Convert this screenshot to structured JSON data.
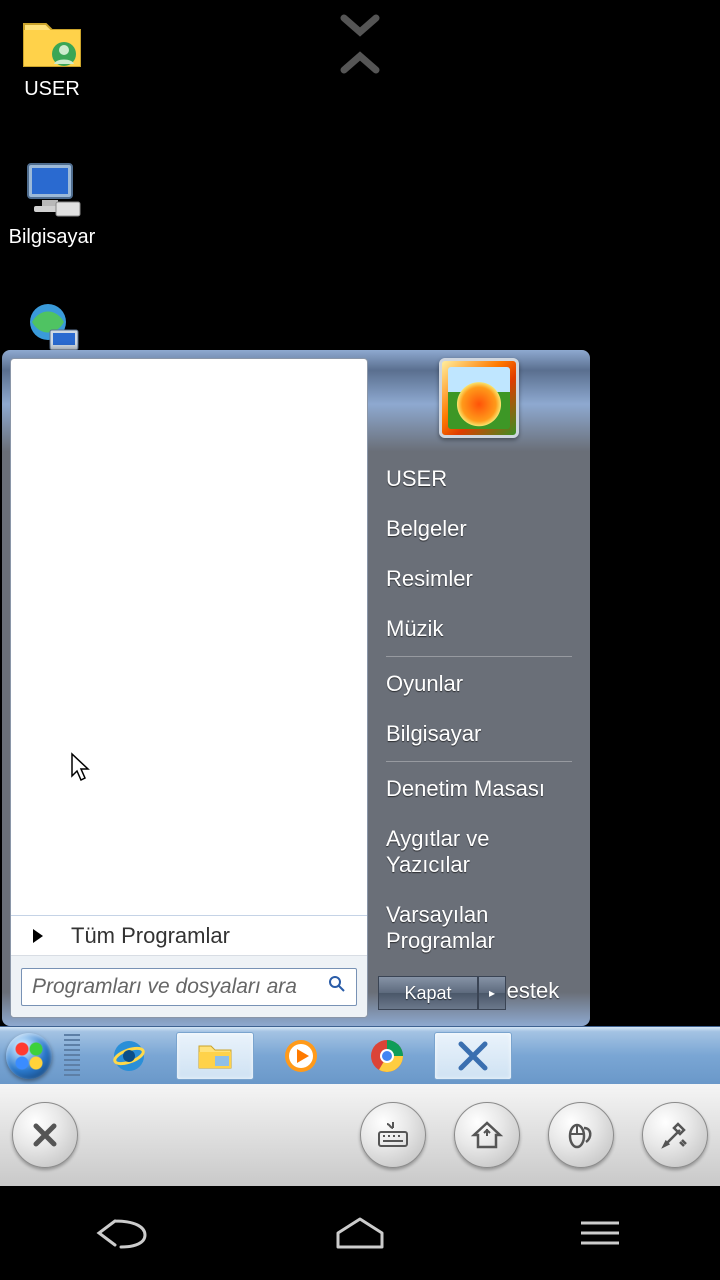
{
  "desktop": {
    "icons": [
      {
        "label": "USER"
      },
      {
        "label": "Bilgisayar"
      }
    ]
  },
  "start_menu": {
    "all_programs": "Tüm Programlar",
    "search_placeholder": "Programları ve dosyaları ara",
    "shutdown_label": "Kapat",
    "right": [
      "USER",
      "Belgeler",
      "Resimler",
      "Müzik",
      "Oyunlar",
      "Bilgisayar",
      "Denetim Masası",
      "Aygıtlar ve Yazıcılar",
      "Varsayılan Programlar",
      "Yardım ve Destek"
    ]
  },
  "taskbar": {
    "items": [
      "internet-explorer",
      "file-explorer",
      "media-player",
      "google-chrome",
      "x-app"
    ]
  },
  "remote_toolbar": {
    "buttons": [
      "close",
      "keyboard",
      "home",
      "mouse",
      "settings"
    ]
  }
}
